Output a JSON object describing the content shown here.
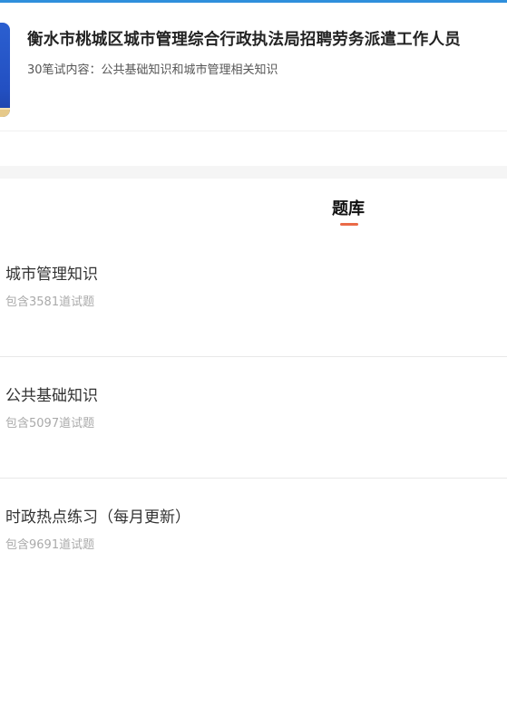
{
  "header": {
    "exam_title": "衡水市桃城区城市管理综合行政执法局招聘劳务派遣工作人员",
    "exam_subtitle": "30笔试内容：公共基础知识和城市管理相关知识"
  },
  "tabs": [
    {
      "label": "题库",
      "active": true
    }
  ],
  "question_banks": [
    {
      "name": "城市管理知识",
      "count_text": "包含3581道试题"
    },
    {
      "name": "公共基础知识",
      "count_text": "包含5097道试题"
    },
    {
      "name": "时政热点练习（每月更新）",
      "count_text": "包含9691道试题"
    }
  ],
  "colors": {
    "top_accent": "#2f8fdc",
    "tab_indicator": "#ea6a47",
    "book_cover": "#2350c2"
  }
}
